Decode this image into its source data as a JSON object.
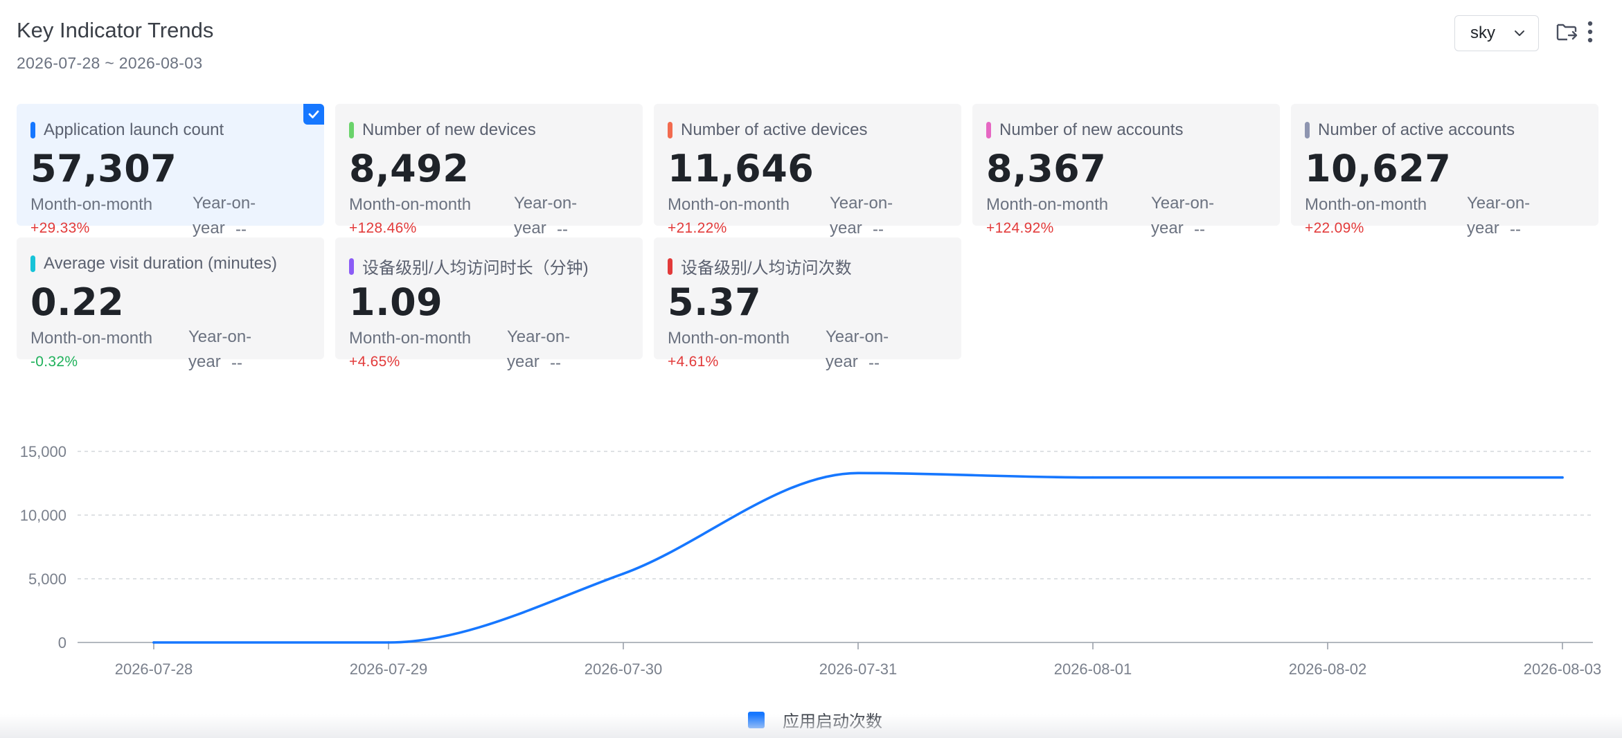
{
  "header": {
    "title": "Key Indicator Trends",
    "date_range": "2026-07-28 ~ 2026-08-03",
    "app_select_value": "sky"
  },
  "cards": [
    {
      "label": "Application launch count",
      "value": "57,307",
      "mom_label": "Month-on-month",
      "mom": "+29.33%",
      "mom_dir": "up",
      "yoy_label": "Year-on-year",
      "yoy": "--",
      "color": "#1677ff",
      "selected": true
    },
    {
      "label": "Number of new devices",
      "value": "8,492",
      "mom_label": "Month-on-month",
      "mom": "+128.46%",
      "mom_dir": "up",
      "yoy_label": "Year-on-year",
      "yoy": "--",
      "color": "#6ad36b",
      "selected": false
    },
    {
      "label": "Number of active devices",
      "value": "11,646",
      "mom_label": "Month-on-month",
      "mom": "+21.22%",
      "mom_dir": "up",
      "yoy_label": "Year-on-year",
      "yoy": "--",
      "color": "#f26b4f",
      "selected": false
    },
    {
      "label": "Number of new accounts",
      "value": "8,367",
      "mom_label": "Month-on-month",
      "mom": "+124.92%",
      "mom_dir": "up",
      "yoy_label": "Year-on-year",
      "yoy": "--",
      "color": "#e667c3",
      "selected": false
    },
    {
      "label": "Number of active accounts",
      "value": "10,627",
      "mom_label": "Month-on-month",
      "mom": "+22.09%",
      "mom_dir": "up",
      "yoy_label": "Year-on-year",
      "yoy": "--",
      "color": "#8e95b0",
      "selected": false
    },
    {
      "label": "Average visit duration (minutes)",
      "value": "0.22",
      "mom_label": "Month-on-month",
      "mom": "-0.32%",
      "mom_dir": "down",
      "yoy_label": "Year-on-year",
      "yoy": "--",
      "color": "#17c3d8",
      "selected": false
    },
    {
      "label": "设备级别/人均访问时长（分钟)",
      "value": "1.09",
      "mom_label": "Month-on-month",
      "mom": "+4.65%",
      "mom_dir": "up",
      "yoy_label": "Year-on-year",
      "yoy": "--",
      "color": "#8b5cf6",
      "selected": false
    },
    {
      "label": "设备级别/人均访问次数",
      "value": "5.37",
      "mom_label": "Month-on-month",
      "mom": "+4.61%",
      "mom_dir": "up",
      "yoy_label": "Year-on-year",
      "yoy": "--",
      "color": "#e23a3a",
      "selected": false
    }
  ],
  "colors": {
    "accent": "#1677ff",
    "increase": "#e23a3a",
    "decrease": "#1fb15b"
  },
  "chart_data": {
    "type": "line",
    "categories": [
      "2026-07-28",
      "2026-07-29",
      "2026-07-30",
      "2026-07-31",
      "2026-08-01",
      "2026-08-02",
      "2026-08-03"
    ],
    "series": [
      {
        "name": "应用启动次数",
        "values": [
          0,
          0,
          5400,
          13300,
          12950,
          12950,
          12950
        ],
        "color": "#1677ff"
      }
    ],
    "y_ticks": [
      "0",
      "5,000",
      "10,000",
      "15,000"
    ],
    "ylim": [
      0,
      15000
    ],
    "grid": true,
    "smooth": true,
    "legend_position": "bottom-center"
  }
}
